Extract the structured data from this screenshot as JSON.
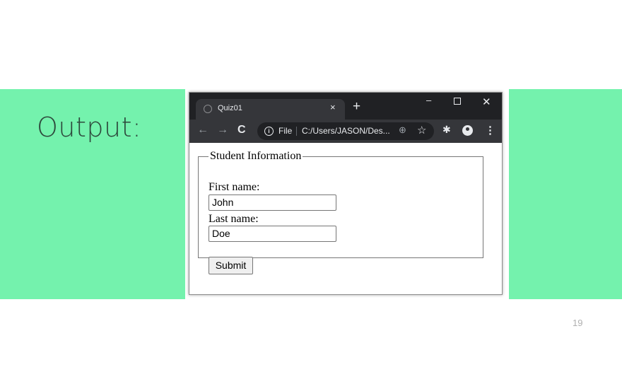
{
  "slide": {
    "heading": "Output:",
    "page_number": "19",
    "accent_color": "#74f2ad"
  },
  "browser": {
    "tab_title": "Quiz01",
    "tab_close": "×",
    "new_tab": "+",
    "window_controls": {
      "minimize": "–",
      "close": "✕"
    },
    "nav": {
      "back": "←",
      "forward": "→",
      "reload": "C"
    },
    "omnibox": {
      "info": "i",
      "scheme_label": "File",
      "url": "C:/Users/JASON/Des..."
    },
    "icons": {
      "zoom": "⊕",
      "star": "☆",
      "extensions": "✱",
      "menu": "⋮"
    }
  },
  "form": {
    "legend": "Student Information",
    "first_name_label": "First name:",
    "first_name_value": "John",
    "last_name_label": "Last name:",
    "last_name_value": "Doe",
    "submit_label": "Submit"
  }
}
